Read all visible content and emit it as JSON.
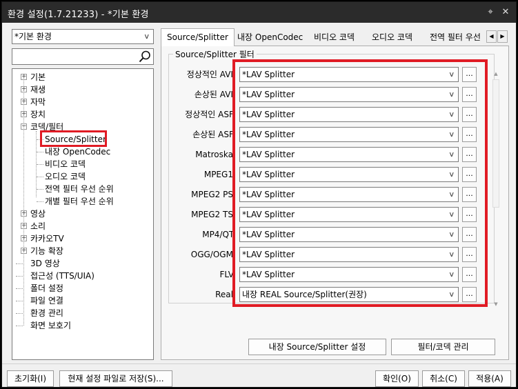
{
  "window": {
    "title": "환경 설정(1.7.21233) - *기본 환경"
  },
  "titlebar_buttons": [
    "pin-icon",
    "close-icon"
  ],
  "preset": {
    "value": "*기본 환경"
  },
  "search": {
    "placeholder": ""
  },
  "tree": {
    "items": [
      {
        "label": "기본",
        "expandable": true
      },
      {
        "label": "재생",
        "expandable": true
      },
      {
        "label": "자막",
        "expandable": true
      },
      {
        "label": "장치",
        "expandable": true
      },
      {
        "label": "코덱/필터",
        "expandable": true,
        "expanded": true
      },
      {
        "label": "Source/Splitter",
        "child": true,
        "selected": true
      },
      {
        "label": "내장 OpenCodec",
        "child": true
      },
      {
        "label": "비디오 코덱",
        "child": true
      },
      {
        "label": "오디오 코덱",
        "child": true
      },
      {
        "label": "전역 필터 우선 순위",
        "child": true
      },
      {
        "label": "개별 필터 우선 순위",
        "child": true
      },
      {
        "label": "영상",
        "expandable": true
      },
      {
        "label": "소리",
        "expandable": true
      },
      {
        "label": "카카오TV",
        "expandable": true
      },
      {
        "label": "기능 확장",
        "expandable": true
      },
      {
        "label": "3D 영상"
      },
      {
        "label": "접근성 (TTS/UIA)"
      },
      {
        "label": "폴더 설정"
      },
      {
        "label": "파일 연결"
      },
      {
        "label": "환경 관리"
      },
      {
        "label": "화면 보호기"
      }
    ]
  },
  "tabs": [
    {
      "label": "Source/Splitter",
      "active": true
    },
    {
      "label": "내장 OpenCodec"
    },
    {
      "label": "비디오 코덱"
    },
    {
      "label": "오디오 코덱"
    },
    {
      "label": "전역 필터 우선"
    }
  ],
  "group": {
    "title": "Source/Splitter 필터",
    "rows": [
      {
        "label": "정상적인 AVI:",
        "value": "*LAV Splitter"
      },
      {
        "label": "손상된 AVI:",
        "value": "*LAV Splitter"
      },
      {
        "label": "정상적인 ASF:",
        "value": "*LAV Splitter"
      },
      {
        "label": "손상된 ASF:",
        "value": "*LAV Splitter"
      },
      {
        "label": "Matroska:",
        "value": "*LAV Splitter"
      },
      {
        "label": "MPEG1:",
        "value": "*LAV Splitter"
      },
      {
        "label": "MPEG2 PS:",
        "value": "*LAV Splitter"
      },
      {
        "label": "MPEG2 TS:",
        "value": "*LAV Splitter"
      },
      {
        "label": "MP4/QT:",
        "value": "*LAV Splitter"
      },
      {
        "label": "OGG/OGM:",
        "value": "*LAV Splitter"
      },
      {
        "label": "FLV:",
        "value": "*LAV Splitter"
      },
      {
        "label": "Real:",
        "value": "내장 REAL Source/Splitter(권장)"
      }
    ],
    "dots_label": "...",
    "arrow": "v"
  },
  "panel_buttons": {
    "builtin_settings": "내장 Source/Splitter 설정",
    "filter_manage": "필터/코덱 관리"
  },
  "footer": {
    "reset": "초기화(I)",
    "save_current": "현재 설정 파일로 저장(S)...",
    "ok": "확인(O)",
    "cancel": "취소(C)",
    "apply": "적용(A)"
  },
  "colors": {
    "highlight": "#e01b24",
    "titlebar": "#2b2b2b"
  }
}
